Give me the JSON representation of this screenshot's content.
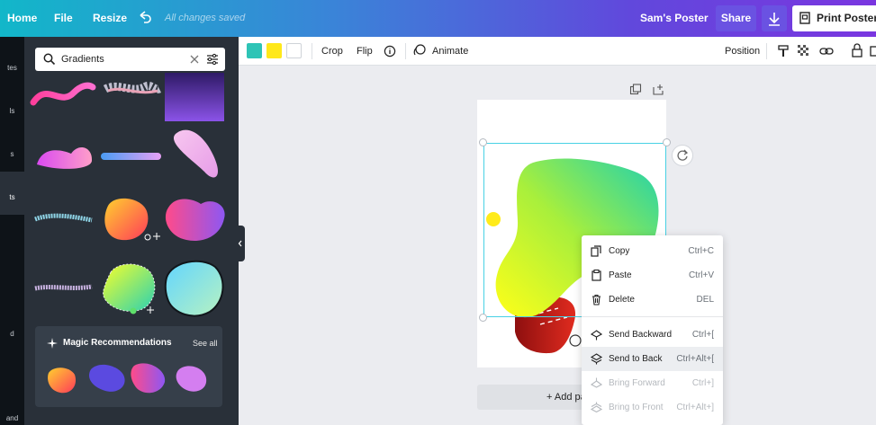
{
  "topbar": {
    "home": "Home",
    "file": "File",
    "resize": "Resize",
    "save_status": "All changes saved",
    "doc_title": "Sam's Poster",
    "share": "Share",
    "print": "Print Posters"
  },
  "rail": {
    "labels": [
      "tes",
      "ls",
      "s",
      "ts",
      "d",
      "and"
    ]
  },
  "panel": {
    "search": {
      "value": "Gradients"
    },
    "magic": {
      "title": "Magic Recommendations",
      "see_all": "See all"
    }
  },
  "toolbar": {
    "colors": [
      "#2ec4b6",
      "#ffe81a",
      "#ffffff"
    ],
    "crop": "Crop",
    "flip": "Flip",
    "animate": "Animate",
    "position": "Position"
  },
  "canvas": {
    "add_page": "+ Add page"
  },
  "context_menu": {
    "items": [
      {
        "label": "Copy",
        "shortcut": "Ctrl+C",
        "icon": "copy-icon",
        "enabled": true
      },
      {
        "label": "Paste",
        "shortcut": "Ctrl+V",
        "icon": "paste-icon",
        "enabled": true
      },
      {
        "label": "Delete",
        "shortcut": "DEL",
        "icon": "trash-icon",
        "enabled": true
      },
      {
        "label": "Send Backward",
        "shortcut": "Ctrl+[",
        "icon": "send-backward-icon",
        "enabled": true
      },
      {
        "label": "Send to Back",
        "shortcut": "Ctrl+Alt+[",
        "icon": "send-to-back-icon",
        "enabled": true,
        "highlighted": true
      },
      {
        "label": "Bring Forward",
        "shortcut": "Ctrl+]",
        "icon": "bring-forward-icon",
        "enabled": false
      },
      {
        "label": "Bring to Front",
        "shortcut": "Ctrl+Alt+]",
        "icon": "bring-to-front-icon",
        "enabled": false
      }
    ]
  }
}
